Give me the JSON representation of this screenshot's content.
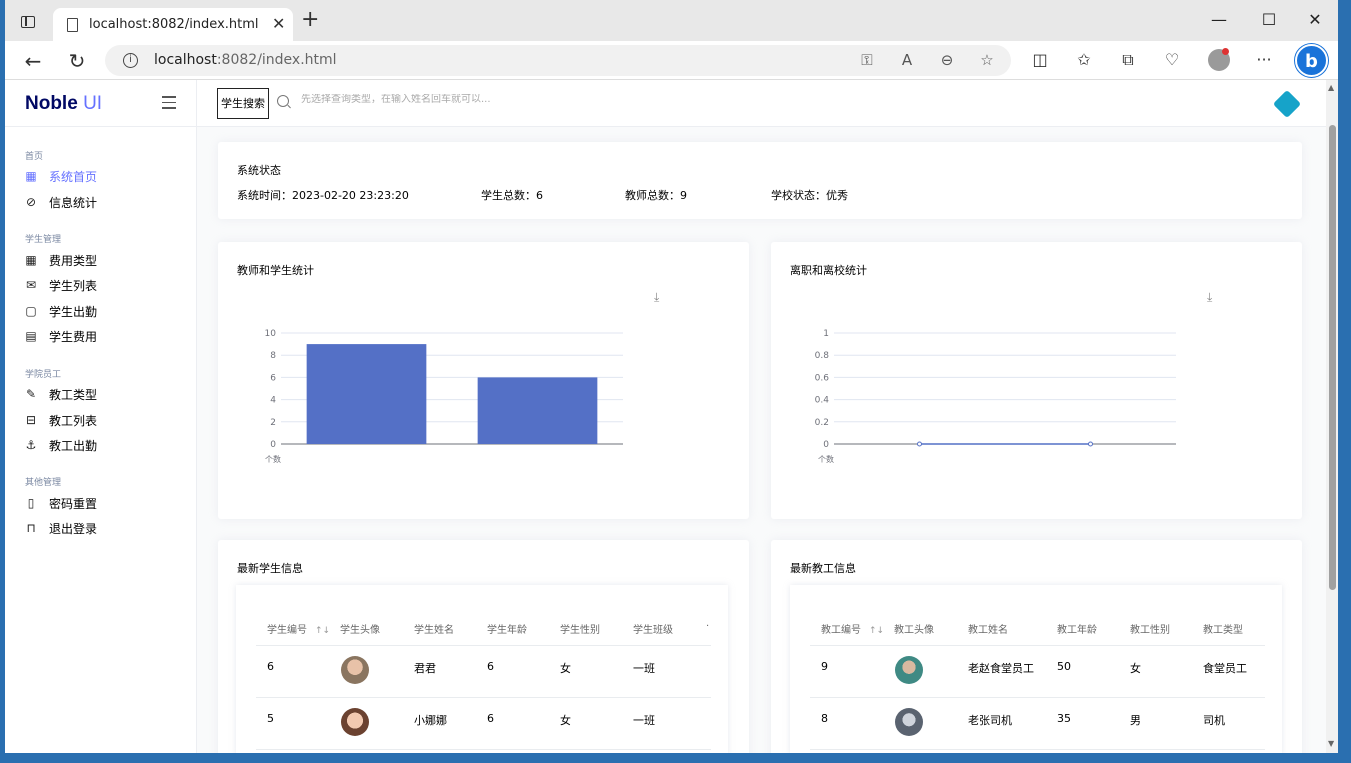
{
  "browser": {
    "tab_title": "localhost:8082/index.html",
    "url_host": "localhost",
    "url_rest": ":8082/index.html"
  },
  "brand": {
    "name": "Noble",
    "suffix": "UI"
  },
  "sidebar": {
    "sections": [
      {
        "label": "首页",
        "items": [
          {
            "label": "系统首页",
            "icon": "layout-icon",
            "active": true
          },
          {
            "label": "信息统计",
            "icon": "eye-off-icon"
          }
        ]
      },
      {
        "label": "学生管理",
        "items": [
          {
            "label": "费用类型",
            "icon": "layout-icon"
          },
          {
            "label": "学生列表",
            "icon": "mail-icon"
          },
          {
            "label": "学生出勤",
            "icon": "message-square-icon"
          },
          {
            "label": "学生费用",
            "icon": "calendar-icon"
          }
        ]
      },
      {
        "label": "学院员工",
        "items": [
          {
            "label": "教工类型",
            "icon": "feather-icon"
          },
          {
            "label": "教工列表",
            "icon": "inbox-icon"
          },
          {
            "label": "教工出勤",
            "icon": "anchor-icon"
          }
        ]
      },
      {
        "label": "其他管理",
        "items": [
          {
            "label": "密码重置",
            "icon": "tablet-icon"
          },
          {
            "label": "退出登录",
            "icon": "unlock-icon"
          }
        ]
      }
    ]
  },
  "topbar": {
    "search_type": "学生搜索",
    "search_placeholder": "先选择查询类型，在输入姓名回车就可以..."
  },
  "status": {
    "title": "系统状态",
    "time_label": "系统时间：",
    "time_value": "2023-02-20 23:23:20",
    "students_label": "学生总数：",
    "students_value": "6",
    "teachers_label": "教师总数：",
    "teachers_value": "9",
    "school_label": "学校状态：",
    "school_value": "优秀"
  },
  "chart_data": [
    {
      "type": "bar",
      "title": "教师和学生统计",
      "categories": [
        "",
        ""
      ],
      "values": [
        9,
        6
      ],
      "ylim": [
        0,
        10
      ],
      "yticks": [
        "0",
        "2",
        "4",
        "6",
        "8",
        "10"
      ],
      "ylabel": "个数",
      "color": "#5470c6"
    },
    {
      "type": "line",
      "title": "离职和离校统计",
      "categories": [
        "",
        ""
      ],
      "values": [
        0,
        0
      ],
      "ylim": [
        0,
        1
      ],
      "yticks": [
        "0",
        "0.2",
        "0.4",
        "0.6",
        "0.8",
        "1"
      ],
      "ylabel": "个数",
      "color": "#5470c6"
    }
  ],
  "students": {
    "title": "最新学生信息",
    "headers": [
      "学生编号",
      "学生头像",
      "学生姓名",
      "学生年龄",
      "学生性别",
      "学生班级"
    ],
    "rows": [
      {
        "id": "6",
        "name": "君君",
        "age": "6",
        "gender": "女",
        "class": "一班"
      },
      {
        "id": "5",
        "name": "小娜娜",
        "age": "6",
        "gender": "女",
        "class": "一班"
      }
    ]
  },
  "teachers": {
    "title": "最新教工信息",
    "headers": [
      "教工编号",
      "教工头像",
      "教工姓名",
      "教工年龄",
      "教工性别",
      "教工类型"
    ],
    "rows": [
      {
        "id": "9",
        "name": "老赵食堂员工",
        "age": "50",
        "gender": "女",
        "type": "食堂员工"
      },
      {
        "id": "8",
        "name": "老张司机",
        "age": "35",
        "gender": "男",
        "type": "司机"
      }
    ]
  },
  "colors": {
    "accent": "#6571ff",
    "brand": "#000864",
    "chart": "#5470c6"
  }
}
